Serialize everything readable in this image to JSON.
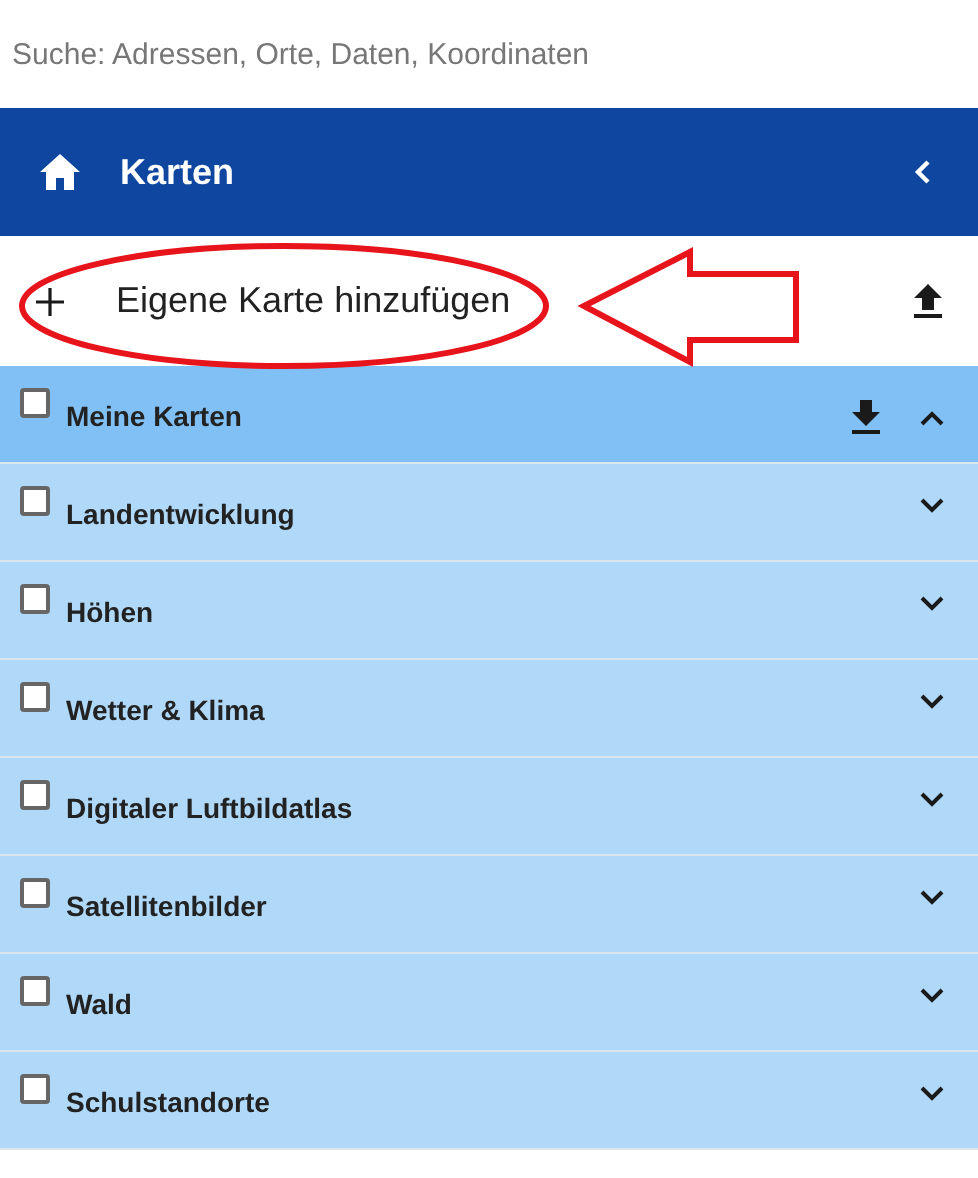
{
  "search": {
    "placeholder": "Suche: Adressen, Orte, Daten, Koordinaten"
  },
  "header": {
    "title": "Karten"
  },
  "add_map": {
    "label": "Eigene Karte hinzufügen"
  },
  "layers": [
    {
      "label": "Meine Karten",
      "checked": false,
      "expanded": true,
      "downloadable": true
    },
    {
      "label": "Landentwicklung",
      "checked": false,
      "expanded": false,
      "downloadable": false
    },
    {
      "label": "Höhen",
      "checked": false,
      "expanded": false,
      "downloadable": false
    },
    {
      "label": "Wetter & Klima",
      "checked": false,
      "expanded": false,
      "downloadable": false
    },
    {
      "label": "Digitaler Luftbildatlas",
      "checked": false,
      "expanded": false,
      "downloadable": false
    },
    {
      "label": "Satellitenbilder",
      "checked": false,
      "expanded": false,
      "downloadable": false
    },
    {
      "label": "Wald",
      "checked": false,
      "expanded": false,
      "downloadable": false
    },
    {
      "label": "Schulstandorte",
      "checked": false,
      "expanded": false,
      "downloadable": false
    }
  ]
}
